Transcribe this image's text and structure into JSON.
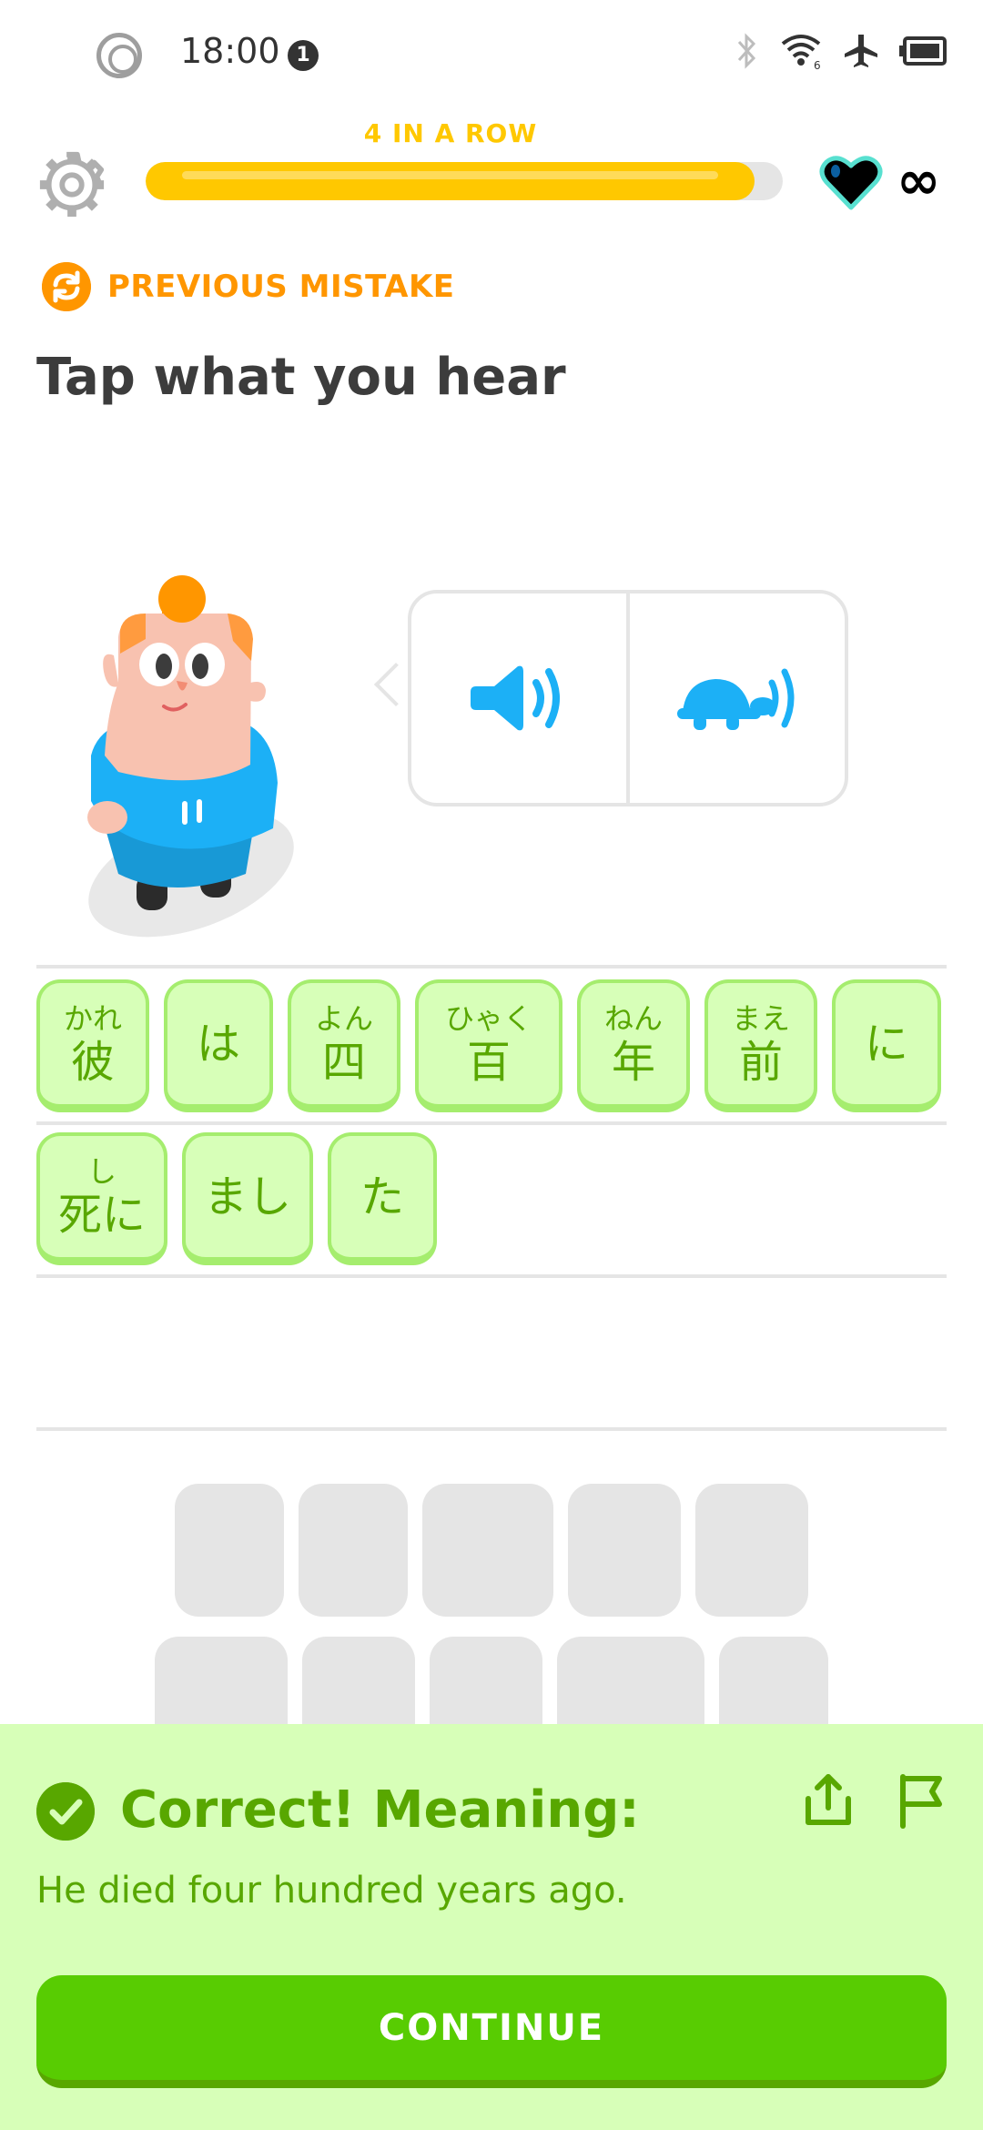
{
  "status_bar": {
    "time": "18:00",
    "notification_count": "1"
  },
  "header": {
    "streak_label": "4 IN A ROW",
    "progress": 0.955,
    "lives": "∞"
  },
  "exercise": {
    "mistake_label": "PREVIOUS MISTAKE",
    "prompt": "Tap what you hear"
  },
  "audio": {
    "normal_icon": "speaker-icon",
    "slow_icon": "turtle-speaker-icon"
  },
  "answer_tiles": [
    {
      "ruby": "かれ",
      "base": "彼"
    },
    {
      "ruby": "",
      "base": "は"
    },
    {
      "ruby": "よん",
      "base": "四"
    },
    {
      "ruby": "ひゃく",
      "base": "百"
    },
    {
      "ruby": "ねん",
      "base": "年"
    },
    {
      "ruby": "まえ",
      "base": "前"
    },
    {
      "ruby": "",
      "base": "に"
    },
    {
      "ruby": "し",
      "base": "死に"
    },
    {
      "ruby": "",
      "base": "まし"
    },
    {
      "ruby": "",
      "base": "た"
    }
  ],
  "feedback": {
    "title": "Correct! Meaning:",
    "meaning": "He died four hundred years ago.",
    "continue_label": "CONTINUE"
  },
  "colors": {
    "accent_green": "#58cc02",
    "dark_green": "#58a700",
    "light_green": "#d7ffb8",
    "streak_yellow": "#ffc800",
    "mistake_orange": "#ff9600",
    "audio_blue": "#1cb0f6"
  }
}
